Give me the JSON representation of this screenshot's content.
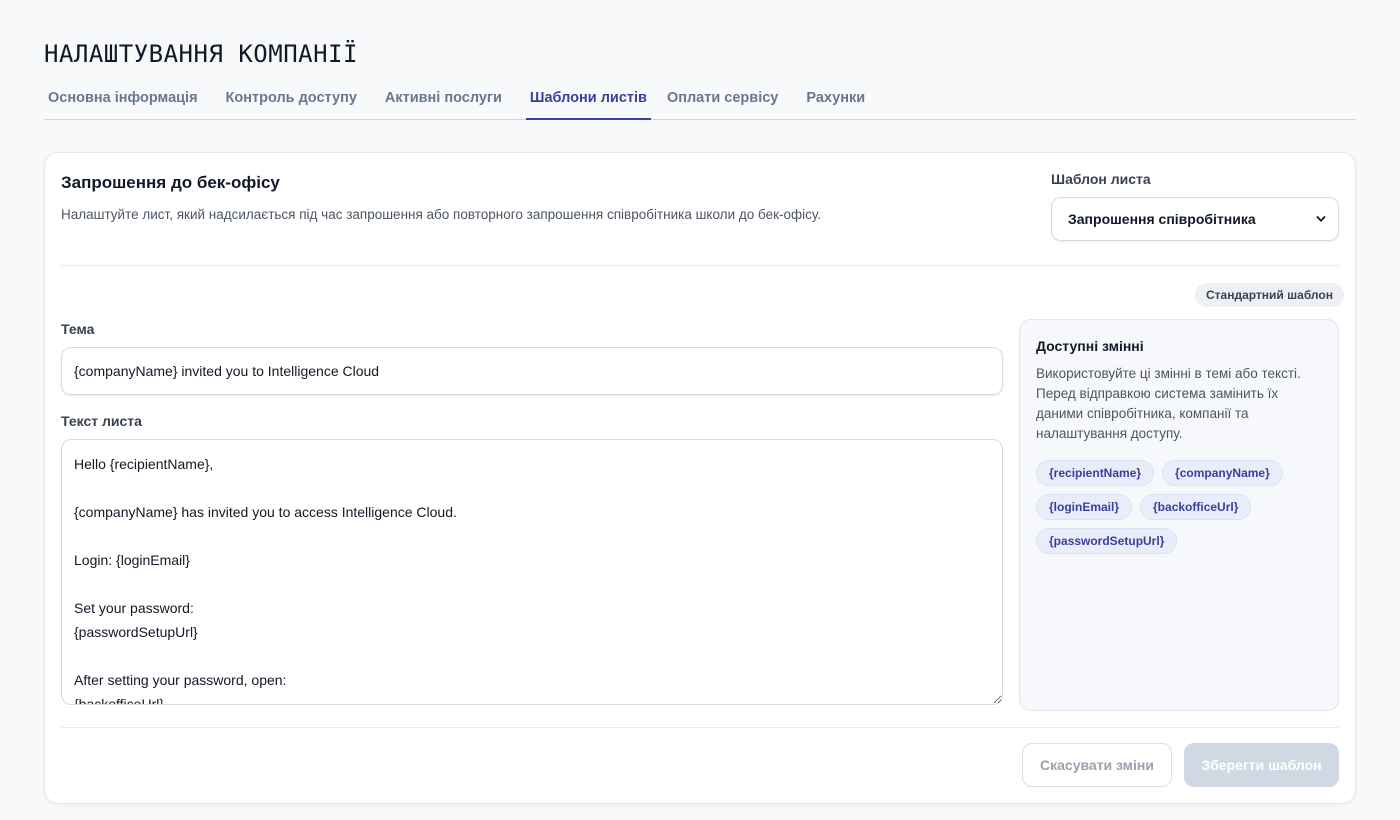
{
  "page": {
    "title": "НАЛАШТУВАННЯ КОМПАНІЇ"
  },
  "tabs": [
    {
      "label": "Основна інформація",
      "active": false
    },
    {
      "label": "Контроль доступу",
      "active": false
    },
    {
      "label": "Активні послуги",
      "active": false
    },
    {
      "label": "Шаблони листів",
      "active": true
    },
    {
      "label": "Оплати сервісу",
      "active": false
    },
    {
      "label": "Рахунки",
      "active": false
    }
  ],
  "card": {
    "title": "Запрошення до бек-офісу",
    "description": "Налаштуйте лист, який надсилається під час запрошення або повторного запрошення співробітника школи до бек-офісу."
  },
  "template_select": {
    "label": "Шаблон листа",
    "value": "Запрошення співробітника"
  },
  "badge": {
    "label": "Стандартний шаблон"
  },
  "subject": {
    "label": "Тема",
    "value": "{companyName} invited you to Intelligence Cloud"
  },
  "body": {
    "label": "Текст листа",
    "value": "Hello {recipientName},\n\n{companyName} has invited you to access Intelligence Cloud.\n\nLogin: {loginEmail}\n\nSet your password:\n{passwordSetupUrl}\n\nAfter setting your password, open:\n{backofficeUrl}"
  },
  "variables": {
    "title": "Доступні змінні",
    "description": "Використовуйте ці змінні в темі або тексті. Перед відправкою система замінить їх даними співробітника, компанії та налаштування доступу.",
    "items": [
      "{recipientName}",
      "{companyName}",
      "{loginEmail}",
      "{backofficeUrl}",
      "{passwordSetupUrl}"
    ]
  },
  "actions": {
    "cancel_label": "Скасувати зміни",
    "save_label": "Зберегти шаблон"
  },
  "colors": {
    "accent": "#3a3f9e",
    "save_disabled": "#cfd8e3"
  }
}
